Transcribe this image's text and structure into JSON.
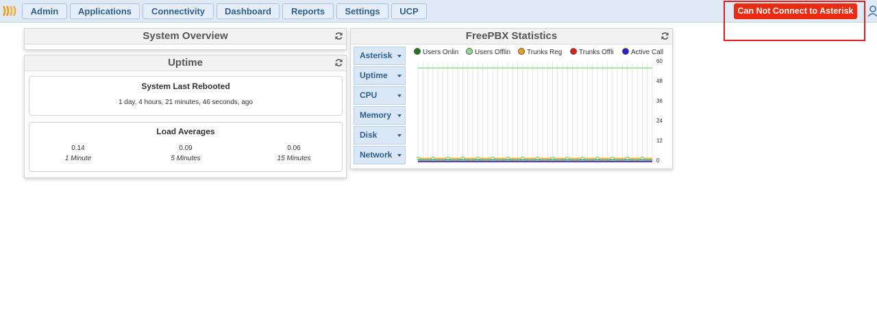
{
  "nav": {
    "items": [
      "Admin",
      "Applications",
      "Connectivity",
      "Dashboard",
      "Reports",
      "Settings",
      "UCP"
    ],
    "alert_label": "Can Not Connect to Asterisk"
  },
  "system_overview": {
    "title": "System Overview"
  },
  "uptime": {
    "title": "Uptime",
    "rebooted_title": "System Last Rebooted",
    "rebooted_value": "1 day, 4 hours, 21 minutes, 46 seconds, ago",
    "load_title": "Load Averages",
    "load": [
      {
        "value": "0.14",
        "label": "1 Minute"
      },
      {
        "value": "0.09",
        "label": "5 Minutes"
      },
      {
        "value": "0.06",
        "label": "15 Minutes"
      }
    ]
  },
  "stats": {
    "title": "FreePBX Statistics",
    "menu": [
      "Asterisk",
      "Uptime",
      "CPU",
      "Memory",
      "Disk",
      "Network"
    ]
  },
  "chart_data": {
    "type": "line",
    "ylim": [
      0,
      60
    ],
    "yticks": [
      "60",
      "48",
      "36",
      "24",
      "12",
      "0"
    ],
    "series": [
      {
        "name": "Users Onlin",
        "color": "#1d7a1d",
        "values": [
          1,
          1,
          1,
          1,
          1,
          1,
          1,
          1,
          1,
          1,
          1,
          1,
          1,
          1,
          1,
          1,
          1,
          1,
          1,
          1,
          1,
          1,
          1,
          1,
          1,
          1,
          1,
          1,
          1,
          1,
          1,
          1,
          1,
          1,
          1,
          1,
          1,
          1,
          1,
          1,
          1,
          1,
          1,
          1,
          1,
          1,
          1,
          1
        ]
      },
      {
        "name": "Users Offlin",
        "color": "#8fdc8f",
        "values": [
          57,
          57,
          57,
          57,
          57,
          57,
          57,
          57,
          57,
          57,
          57,
          57,
          57,
          57,
          57,
          57,
          57,
          57,
          57,
          57,
          57,
          57,
          57,
          57,
          57,
          57,
          57,
          57,
          57,
          57,
          57,
          57,
          57,
          57,
          57,
          57,
          57,
          57,
          57,
          57,
          57,
          57,
          57,
          57,
          57,
          57,
          57,
          57
        ]
      },
      {
        "name": "Trunks Reg",
        "color": "#f0a020",
        "values": [
          2,
          2,
          2,
          2,
          2,
          2,
          2,
          2,
          2,
          2,
          2,
          2,
          2,
          2,
          2,
          2,
          2,
          2,
          2,
          2,
          2,
          2,
          2,
          2,
          2,
          2,
          2,
          2,
          2,
          2,
          2,
          2,
          2,
          2,
          2,
          2,
          2,
          2,
          2,
          2,
          2,
          2,
          2,
          2,
          2,
          2,
          2,
          2
        ]
      },
      {
        "name": "Trunks Offli",
        "color": "#e02010",
        "values": [
          0,
          0,
          0,
          0,
          0,
          0,
          0,
          0,
          0,
          0,
          0,
          0,
          0,
          0,
          0,
          0,
          0,
          0,
          0,
          0,
          0,
          0,
          0,
          0,
          0,
          0,
          0,
          0,
          0,
          0,
          0,
          0,
          0,
          0,
          0,
          0,
          0,
          0,
          0,
          0,
          0,
          0,
          0,
          0,
          0,
          0,
          0,
          0
        ]
      },
      {
        "name": "Active Call",
        "color": "#2a1dd6",
        "values": [
          0,
          0,
          0,
          0,
          0,
          0,
          0,
          0,
          0,
          0,
          0,
          0,
          0,
          0,
          0,
          0,
          0,
          0,
          0,
          0,
          0,
          0,
          0,
          0,
          0,
          0,
          0,
          0,
          0,
          0,
          0,
          0,
          0,
          0,
          0,
          0,
          0,
          0,
          0,
          0,
          0,
          0,
          0,
          0,
          0,
          0,
          0,
          0
        ]
      }
    ],
    "grid": true
  }
}
